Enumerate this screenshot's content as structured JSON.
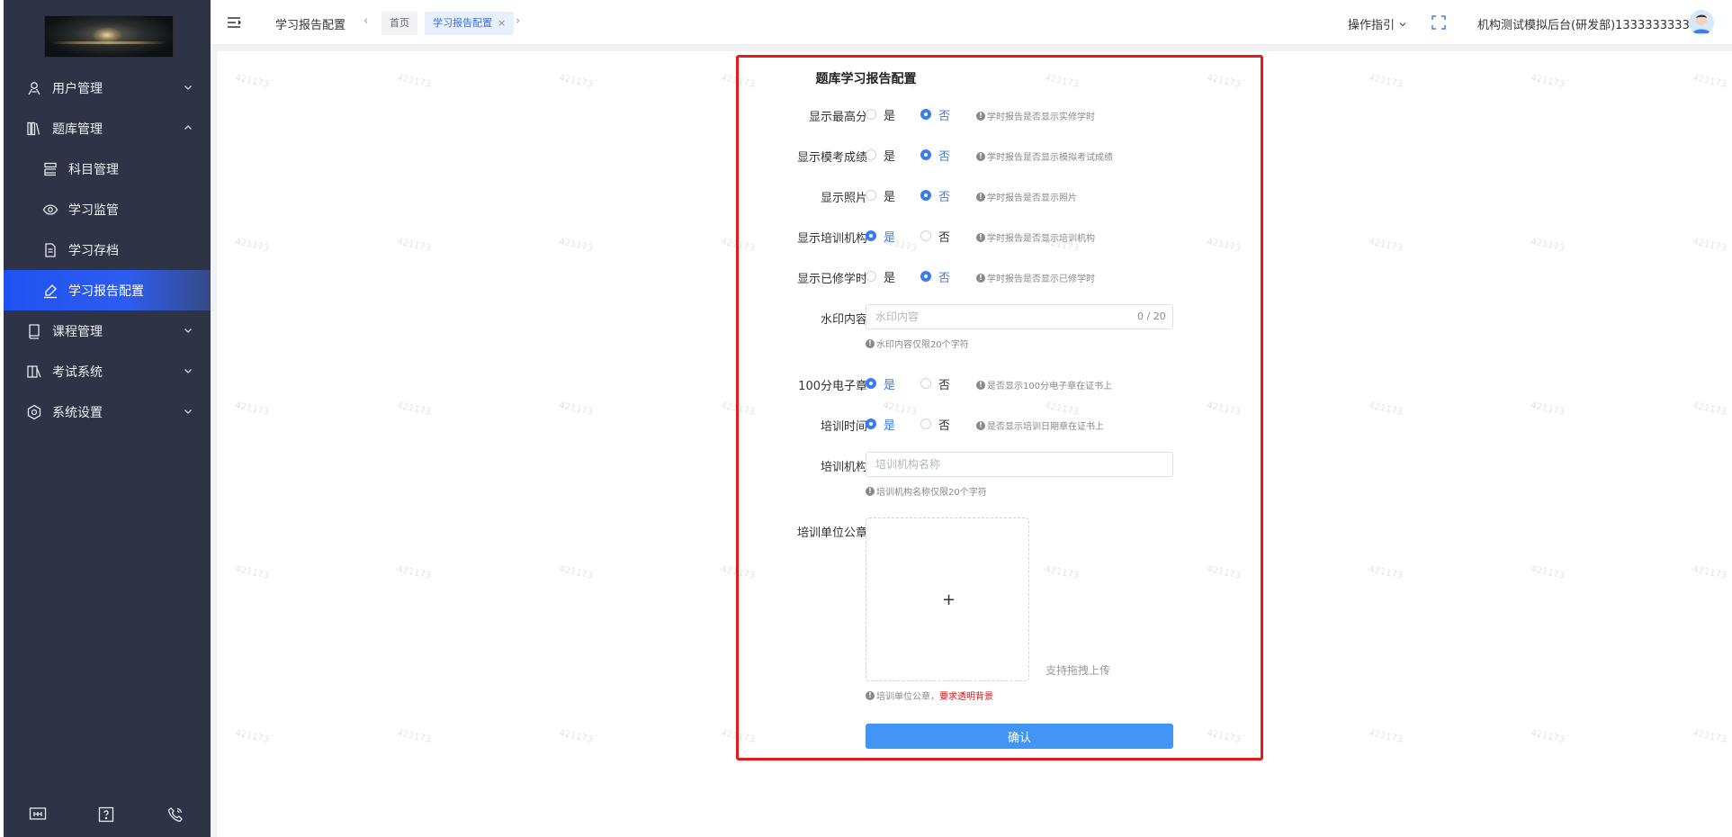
{
  "sidebar": {
    "menu": [
      {
        "label": "用户管理",
        "icon": "users-icon"
      },
      {
        "label": "题库管理",
        "icon": "library-icon"
      },
      {
        "label": "科目管理",
        "icon": "list-icon"
      },
      {
        "label": "学习监管",
        "icon": "eye-icon"
      },
      {
        "label": "学习存档",
        "icon": "file-icon"
      },
      {
        "label": "学习报告配置",
        "icon": "edit-icon"
      },
      {
        "label": "课程管理",
        "icon": "book-icon"
      },
      {
        "label": "考试系统",
        "icon": "exam-icon"
      },
      {
        "label": "系统设置",
        "icon": "settings-icon"
      }
    ],
    "watermark": "421173"
  },
  "header": {
    "title": "学习报告配置",
    "tabs": [
      {
        "label": "首页"
      },
      {
        "label": "学习报告配置",
        "close": "×"
      }
    ],
    "guide_label": "操作指引",
    "user_name": "机构测试模拟后台(研发部)1333333333"
  },
  "form": {
    "title": "题库学习报告配置",
    "yes": "是",
    "no": "否",
    "rows": [
      {
        "label": "显示最高分",
        "hint": "学时报告是否显示实修学时",
        "selected": "no"
      },
      {
        "label": "显示模考成绩",
        "hint": "学时报告是否显示模拟考试成绩",
        "selected": "no"
      },
      {
        "label": "显示照片",
        "hint": "学时报告是否显示照片",
        "selected": "no"
      },
      {
        "label": "显示培训机构",
        "hint": "学时报告是否显示培训机构",
        "selected": "yes"
      },
      {
        "label": "显示已修学时",
        "hint": "学时报告是否显示已修学时",
        "selected": "no"
      }
    ],
    "watermark": {
      "label": "水印内容",
      "placeholder": "水印内容",
      "counter": "0 / 20",
      "hint": "水印内容仅限20个字符"
    },
    "stamp100": {
      "label": "100分电子章",
      "hint": "是否显示100分电子章在证书上",
      "selected": "yes"
    },
    "train_time": {
      "label": "培训时间",
      "hint": "是否显示培训日期章在证书上",
      "selected": "yes"
    },
    "org": {
      "label": "培训机构",
      "placeholder": "培训机构名称",
      "hint": "培训机构名称仅限20个字符"
    },
    "seal": {
      "label": "培训单位公章",
      "plus": "+",
      "drag_text": "支持拖拽上传",
      "hint_prefix": "培训单位公章，",
      "hint_red": "要求透明背景"
    },
    "confirm_label": "确认",
    "colors": {
      "primary": "#4095f5",
      "frame": "#e21b1b",
      "sidebar": "#2e3446",
      "active": "#1f52ef"
    }
  }
}
